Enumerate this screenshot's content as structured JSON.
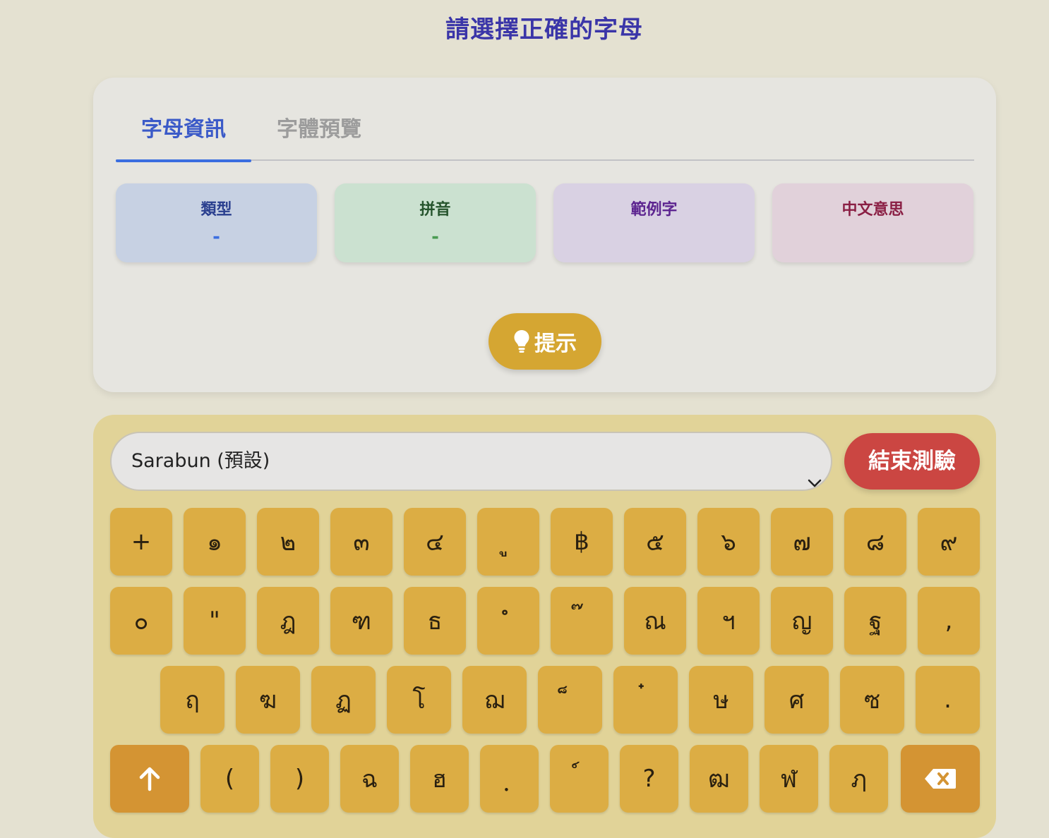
{
  "page": {
    "title": "請選擇正確的字母"
  },
  "tabs": [
    {
      "label": "字母資訊",
      "active": true
    },
    {
      "label": "字體預覽",
      "active": false
    }
  ],
  "info": {
    "type": {
      "label": "類型",
      "value": "-"
    },
    "pinyin": {
      "label": "拼音",
      "value": "-"
    },
    "example": {
      "label": "範例字",
      "value": ""
    },
    "meaning": {
      "label": "中文意思",
      "value": ""
    }
  },
  "hint": {
    "label": "提示",
    "icon": "lightbulb-icon"
  },
  "font_select": {
    "value": "Sarabun (預設)",
    "icon": "chevron-down-icon"
  },
  "end_button": {
    "label": "結束測驗"
  },
  "keyboard": {
    "row1": [
      "+",
      "๑",
      "๒",
      "๓",
      "๔",
      "ู",
      "฿",
      "๕",
      "๖",
      "๗",
      "๘",
      "๙"
    ],
    "row2": [
      "๐",
      "\"",
      "ฎ",
      "ฑ",
      "ธ",
      "ํ",
      "๊",
      "ณ",
      "ฯ",
      "ญ",
      "ฐ",
      ","
    ],
    "row3": [
      "ฤ",
      "ฆ",
      "ฏ",
      "โ",
      "ฌ",
      "็",
      "๋",
      "ษ",
      "ศ",
      "ซ",
      "."
    ],
    "row4": [
      "(",
      ")",
      "ฉ",
      "ฮ",
      "ฺ",
      "์",
      "?",
      "ฒ",
      "ฬ",
      "ฦ"
    ],
    "shift_icon": "arrow-up-icon",
    "backspace_icon": "backspace-icon"
  },
  "colors": {
    "title": "#3a35a8",
    "tab_active": "#3b5ac8",
    "key": "#dcad44",
    "key_function": "#d49433",
    "hint": "#d5a632",
    "end_button": "#cb4642"
  }
}
